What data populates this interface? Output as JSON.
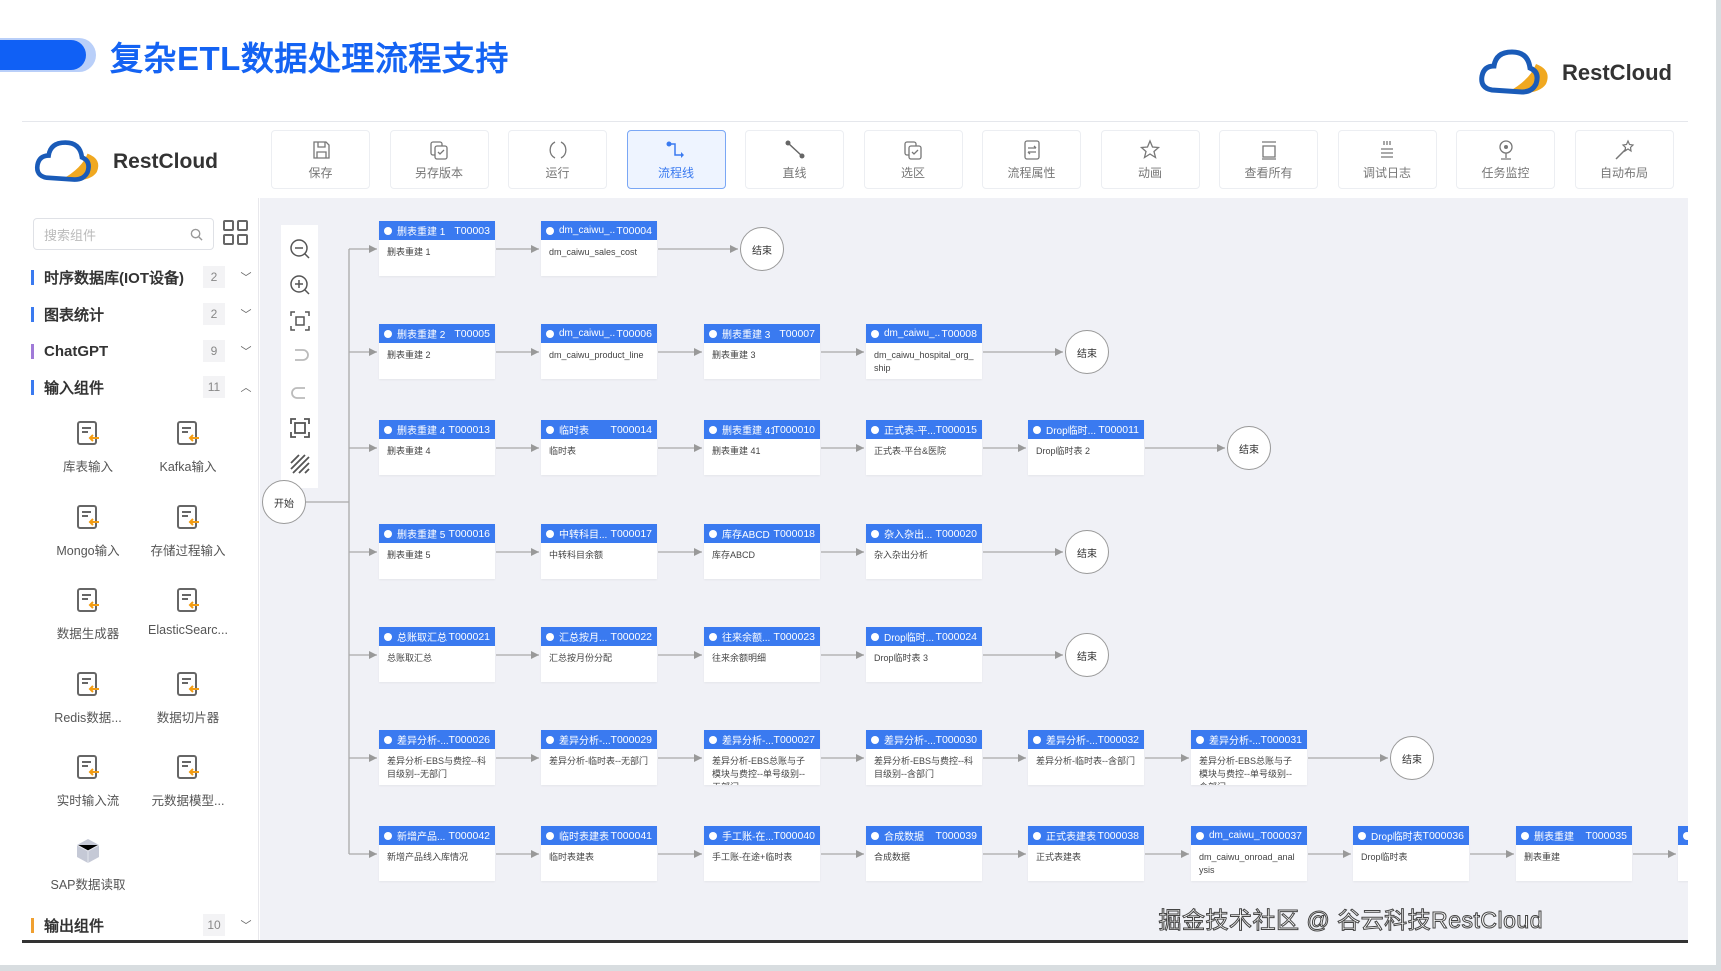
{
  "slide_title": "复杂ETL数据处理流程支持",
  "brand": "RestCloud",
  "toolbar": [
    {
      "label": "保存",
      "icon": "save-icon"
    },
    {
      "label": "另存版本",
      "icon": "copy-icon"
    },
    {
      "label": "运行",
      "icon": "run-icon"
    },
    {
      "label": "流程线",
      "icon": "flow-line-icon",
      "active": true
    },
    {
      "label": "直线",
      "icon": "straight-line-icon"
    },
    {
      "label": "选区",
      "icon": "selection-icon"
    },
    {
      "label": "流程属性",
      "icon": "properties-icon"
    },
    {
      "label": "动画",
      "icon": "star-icon"
    },
    {
      "label": "查看所有",
      "icon": "view-all-icon"
    },
    {
      "label": "调试日志",
      "icon": "log-icon"
    },
    {
      "label": "任务监控",
      "icon": "monitor-icon"
    },
    {
      "label": "自动布局",
      "icon": "magic-wand-icon"
    }
  ],
  "sidebar": {
    "search_placeholder": "搜索组件",
    "categories": [
      {
        "name": "时序数据库(IOT设备)",
        "count": "2",
        "expanded": false,
        "color": "#3a7af0"
      },
      {
        "name": "图表统计",
        "count": "2",
        "expanded": false,
        "color": "#3a7af0"
      },
      {
        "name": "ChatGPT",
        "count": "9",
        "expanded": false,
        "color": "#a07ad8"
      },
      {
        "name": "输入组件",
        "count": "11",
        "expanded": true,
        "color": "#3a7af0"
      }
    ],
    "components": [
      "库表输入",
      "Kafka输入",
      "Mongo输入",
      "存储过程输入",
      "数据生成器",
      "ElasticSearc...",
      "Redis数据...",
      "数据切片器",
      "实时输入流",
      "元数据模型...",
      "SAP数据读取"
    ],
    "output_category": {
      "name": "输出组件",
      "count": "10",
      "expanded": false,
      "color": "#f0a030"
    }
  },
  "canvas": {
    "start_label": "开始",
    "end_label": "结束",
    "rows": [
      [
        [
          "删表重建 1",
          "T00003",
          "删表重建 1"
        ],
        [
          "dm_caiwu_...",
          "T00004",
          "dm_caiwu_sales_cost"
        ]
      ],
      [
        [
          "删表重建 2",
          "T00005",
          "删表重建 2"
        ],
        [
          "dm_caiwu_...",
          "T00006",
          "dm_caiwu_product_line"
        ],
        [
          "删表重建 3",
          "T00007",
          "删表重建 3"
        ],
        [
          "dm_caiwu_...",
          "T00008",
          "dm_caiwu_hospital_org_ship"
        ]
      ],
      [
        [
          "删表重建 4",
          "T000013",
          "删表重建 4"
        ],
        [
          "临时表",
          "T000014",
          "临时表"
        ],
        [
          "删表重建 41",
          "T000010",
          "删表重建 41"
        ],
        [
          "正式表-平...",
          "T000015",
          "正式表-平台&医院"
        ],
        [
          "Drop临时...",
          "T000011",
          "Drop临时表 2"
        ]
      ],
      [
        [
          "删表重建 5",
          "T000016",
          "删表重建 5"
        ],
        [
          "中转科目...",
          "T000017",
          "中转科目余额"
        ],
        [
          "库存ABCD",
          "T000018",
          "库存ABCD"
        ],
        [
          "杂入杂出...",
          "T000020",
          "杂入杂出分析"
        ]
      ],
      [
        [
          "总账取汇总",
          "T000021",
          "总账取汇总"
        ],
        [
          "汇总按月...",
          "T000022",
          "汇总按月份分配"
        ],
        [
          "往来余额...",
          "T000023",
          "往来余额明细"
        ],
        [
          "Drop临时...",
          "T000024",
          "Drop临时表 3"
        ]
      ],
      [
        [
          "差异分析-...",
          "T000026",
          "差异分析-EBS与费控--科目级别--无部门"
        ],
        [
          "差异分析-...",
          "T000029",
          "差异分析-临时表--无部门"
        ],
        [
          "差异分析-...",
          "T000027",
          "差异分析-EBS总账与子模块与费控--单号级别--无部门"
        ],
        [
          "差异分析-...",
          "T000030",
          "差异分析-EBS与费控--科目级别--含部门"
        ],
        [
          "差异分析-...",
          "T000032",
          "差异分析-临时表--含部门"
        ],
        [
          "差异分析-...",
          "T000031",
          "差异分析-EBS总账与子模块与费控--单号级别--含部门"
        ]
      ],
      [
        [
          "新增产品...",
          "T000042",
          "新增产品线入库情况"
        ],
        [
          "临时表建表",
          "T000041",
          "临时表建表"
        ],
        [
          "手工账-在...",
          "T000040",
          "手工账-在途+临时表"
        ],
        [
          "合成数据",
          "T000039",
          "合成数据"
        ],
        [
          "正式表建表",
          "T000038",
          "正式表建表"
        ],
        [
          "dm_caiwu_...",
          "T000037",
          "dm_caiwu_onroad_analysis"
        ],
        [
          "Drop临时表",
          "T000036",
          "Drop临时表"
        ],
        [
          "删表重建",
          "T000035",
          "删表重建"
        ],
        [
          "",
          "",
          ""
        ]
      ]
    ],
    "row_has_end": [
      true,
      true,
      true,
      true,
      true,
      true,
      false
    ]
  },
  "watermark": "掘金技术社区 @ 谷云科技RestCloud",
  "colors": {
    "accent": "#3a7af0",
    "title": "#1463f3",
    "canvas_bg": "#f0f1f6"
  }
}
